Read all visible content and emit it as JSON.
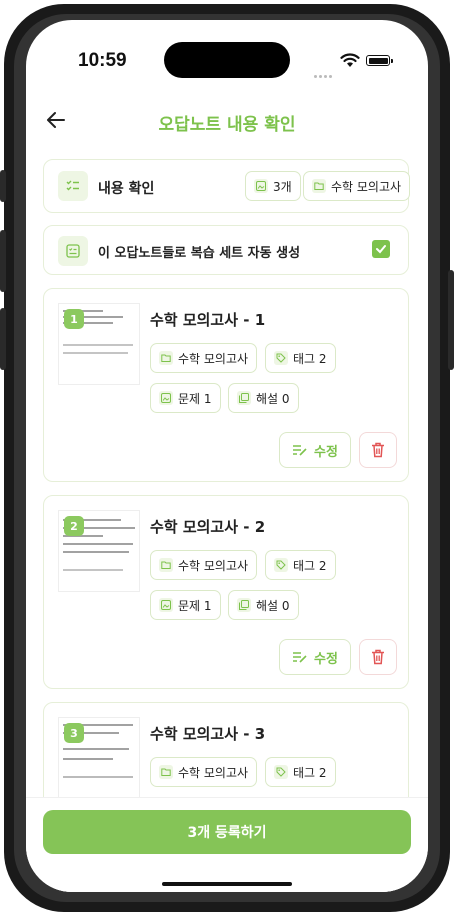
{
  "status": {
    "time": "10:59"
  },
  "header": {
    "title": "오답노트 내용 확인"
  },
  "summary": {
    "label": "내용 확인",
    "count_chip": "3개",
    "subject_chip": "수학 모의고사"
  },
  "auto_review": {
    "label": "이 오답노트들로 복습 세트 자동 생성",
    "checked": true
  },
  "items": [
    {
      "number": "1",
      "title": "수학 모의고사 - 1",
      "subject": "수학 모의고사",
      "tag": "태그 2",
      "problem": "문제 1",
      "solution": "해설 0",
      "edit_label": "수정"
    },
    {
      "number": "2",
      "title": "수학 모의고사 - 2",
      "subject": "수학 모의고사",
      "tag": "태그 2",
      "problem": "문제 1",
      "solution": "해설 0",
      "edit_label": "수정"
    },
    {
      "number": "3",
      "title": "수학 모의고사 - 3",
      "subject": "수학 모의고사",
      "tag": "태그 2"
    }
  ],
  "footer": {
    "register_label": "3개 등록하기"
  },
  "colors": {
    "accent": "#7dc24c",
    "accent_button": "#85c457",
    "delete": "#e25555"
  }
}
